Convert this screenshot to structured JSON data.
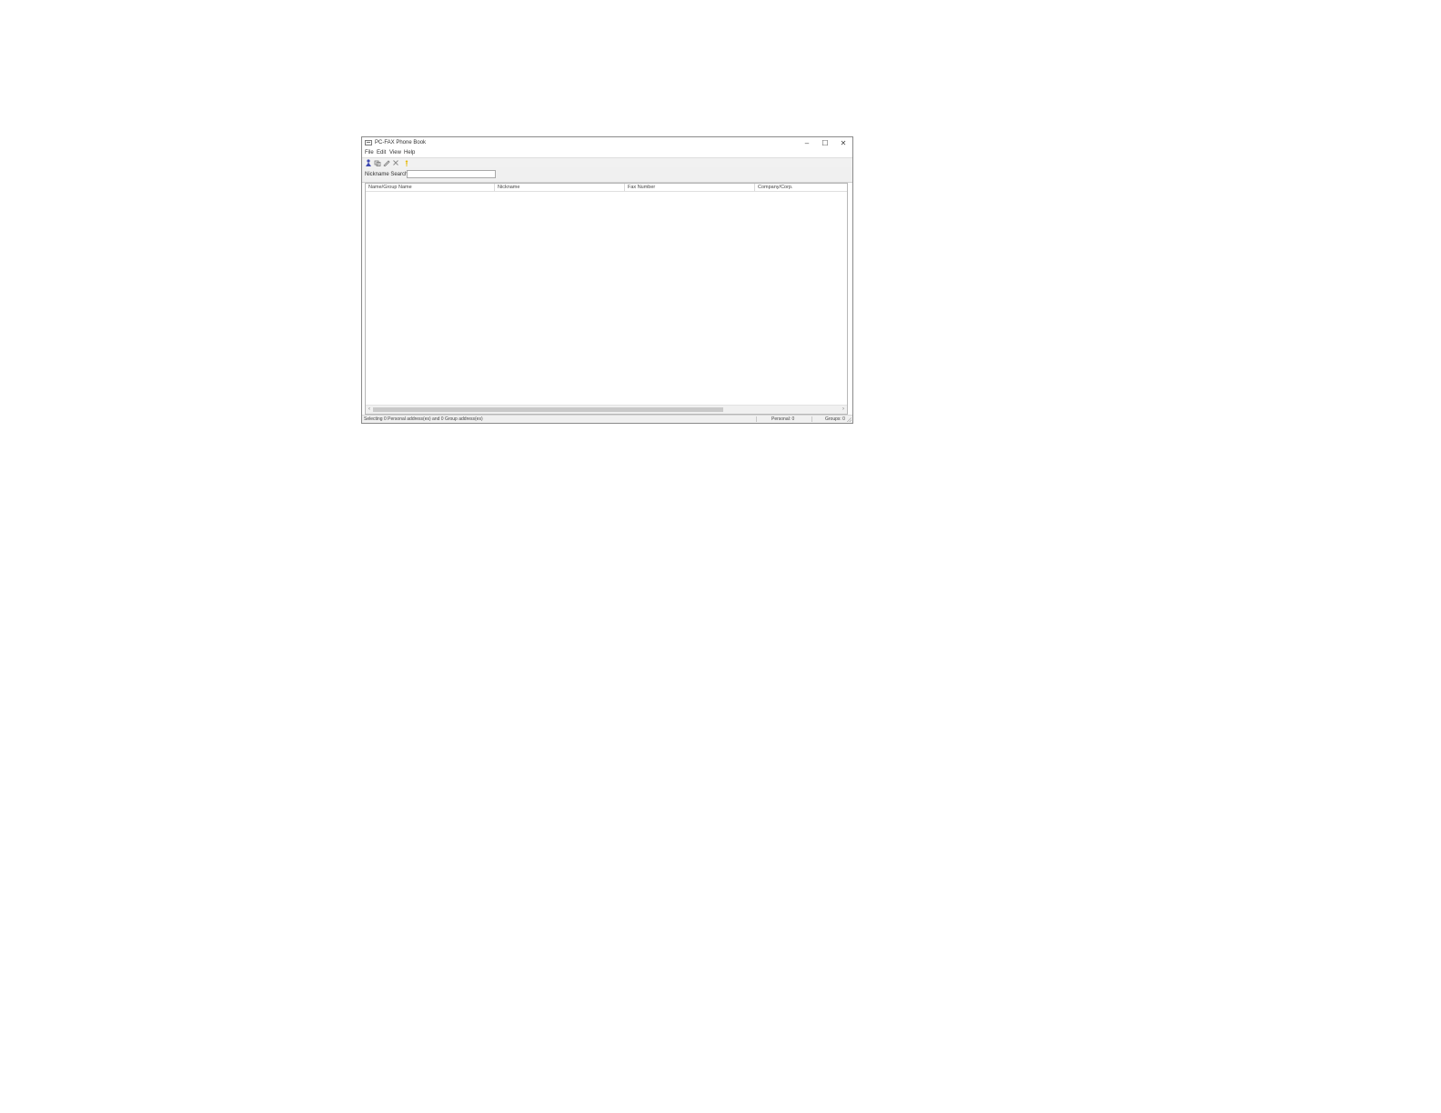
{
  "window": {
    "title": "PC-FAX Phone Book",
    "controls": {
      "minimize": "–",
      "maximize": "☐",
      "close": "✕"
    }
  },
  "menu": [
    "File",
    "Edit",
    "View",
    "Help"
  ],
  "toolbar": {
    "icons": [
      "person-add-icon",
      "group-add-icon",
      "edit-icon",
      "delete-icon",
      "help-icon"
    ],
    "colors": {
      "person": "#3b47b0",
      "help": "#e6b800"
    }
  },
  "search": {
    "label": "Nickname Search:",
    "value": "",
    "placeholder": ""
  },
  "list": {
    "columns": [
      "Name/Group Name",
      "Nickname",
      "Fax Number",
      "Company/Corp."
    ],
    "rows": []
  },
  "scrollbar": {
    "left_arrow": "‹",
    "right_arrow": "›"
  },
  "status": {
    "main": "Selecting 0 Personal address(es) and 0 Group address(es)",
    "personal": "Personal: 0",
    "groups": "Groups: 0"
  }
}
